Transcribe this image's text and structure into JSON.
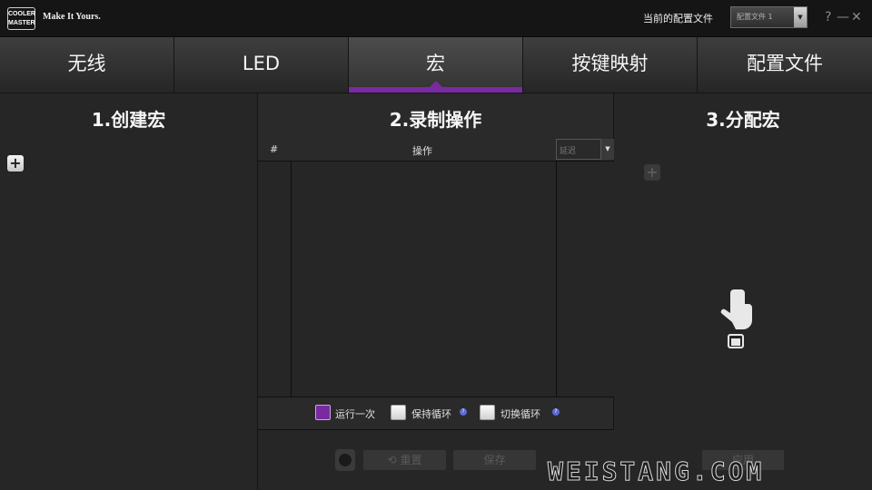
{
  "app": {
    "logo_text": "COOLER MASTER",
    "slogan": "Make It Yours.",
    "profile_label": "当前的配置文件",
    "profile_value": "配置文件 1",
    "window_buttons": [
      "?",
      "—",
      "✕"
    ]
  },
  "tabs": [
    {
      "label": "无线",
      "active": false
    },
    {
      "label": "LED",
      "active": false
    },
    {
      "label": "宏",
      "active": true
    },
    {
      "label": "按键映射",
      "active": false
    },
    {
      "label": "配置文件",
      "active": false
    }
  ],
  "left_panel": {
    "title": "1.创建宏",
    "add_icon": "plus-icon"
  },
  "mid_panel": {
    "title": "2.录制操作",
    "columns": [
      "#",
      "操作",
      "延迟"
    ],
    "loop_options": [
      {
        "label": "运行一次",
        "checked": true,
        "help": false
      },
      {
        "label": "保持循环",
        "checked": false,
        "help": true
      },
      {
        "label": "切换循环",
        "checked": false,
        "help": true
      }
    ],
    "reset_label": "重置",
    "save_label": "保存"
  },
  "right_panel": {
    "title": "3.分配宏",
    "add_icon": "plus-icon",
    "apply_label": "应用"
  },
  "watermark": "WEISTANG.COM",
  "colors": {
    "accent": "#7a2aa0",
    "bg": "#2a2a2a"
  }
}
